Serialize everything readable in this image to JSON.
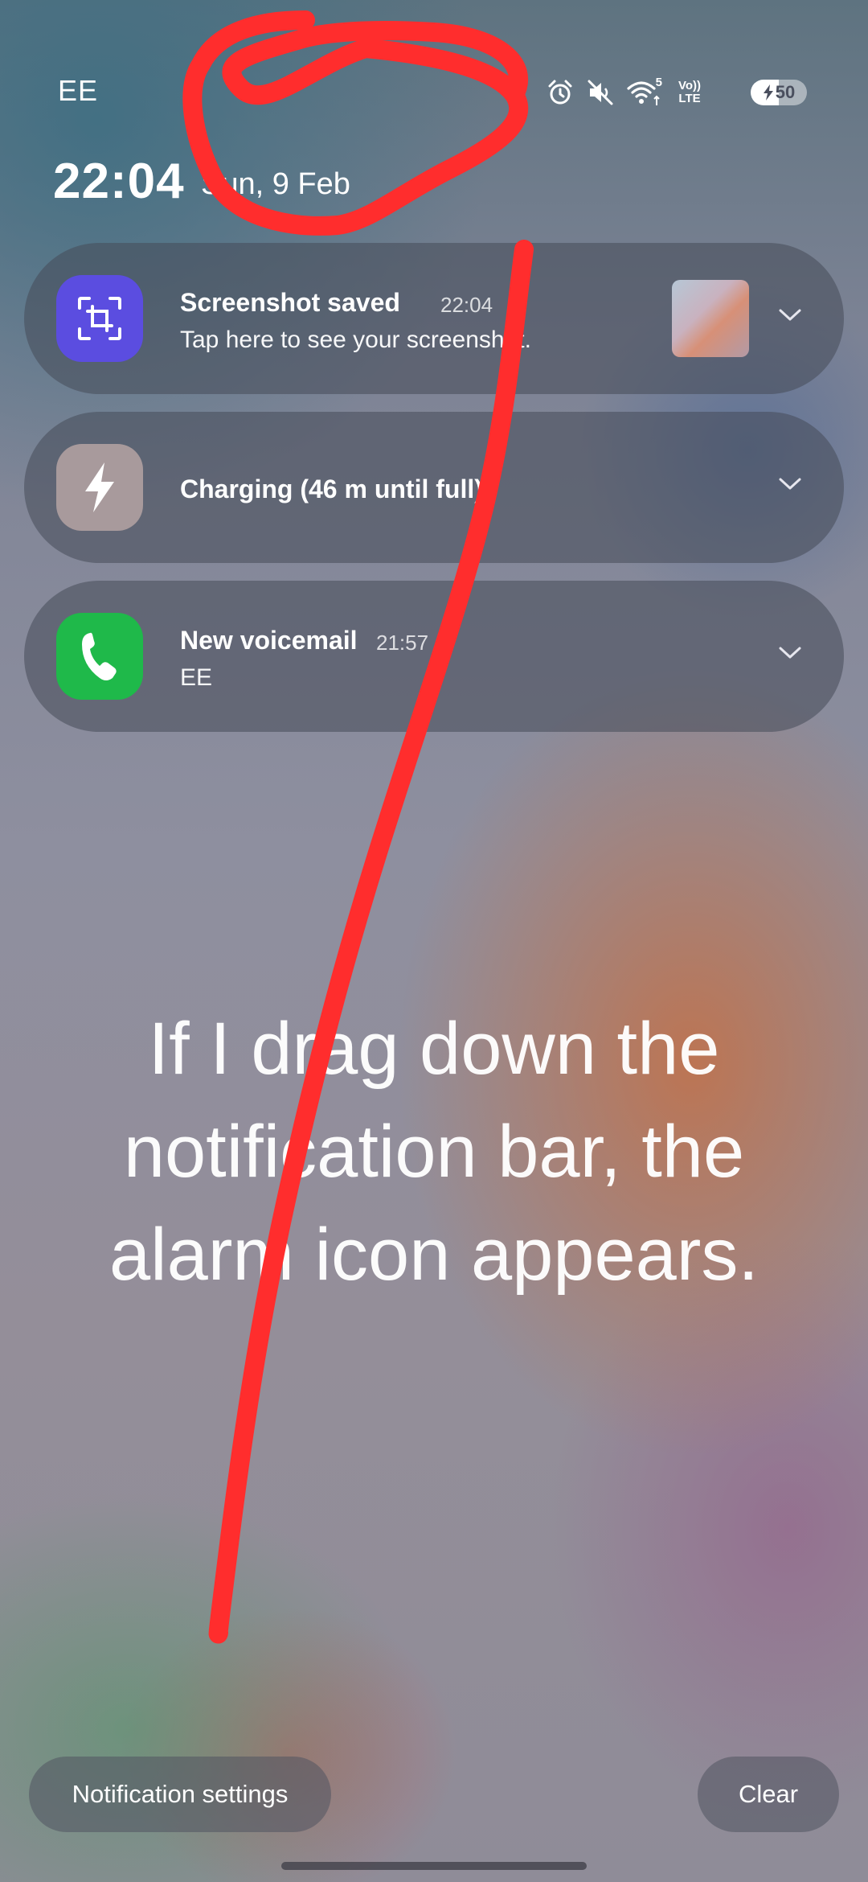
{
  "status_bar": {
    "carrier": "EE",
    "icons": [
      "alarm-icon",
      "mute-icon",
      "wifi-icon",
      "volte-icon"
    ],
    "wifi_label": "5",
    "volte_label_top": "Vo))",
    "volte_label_bottom": "LTE",
    "battery_level": "50",
    "battery_charging": true
  },
  "header": {
    "time": "22:04",
    "date": "Sun, 9 Feb"
  },
  "notifications": [
    {
      "app": "screenshot",
      "icon": "screenshot-icon",
      "title": "Screenshot saved",
      "time": "22:04",
      "body": "Tap here to see your screenshot."
    },
    {
      "app": "charging",
      "icon": "lightning-icon",
      "title": "Charging (46 m until full)"
    },
    {
      "app": "phone",
      "icon": "phone-icon",
      "title": "New voicemail",
      "time": "21:57",
      "body": "EE"
    }
  ],
  "overlay_message": "If I drag down the notification bar, the alarm icon appears.",
  "buttons": {
    "notification_settings": "Notification settings",
    "clear": "Clear"
  },
  "colors": {
    "annotation": "#ff2d2d",
    "screenshot_icon_bg": "#5b4de0",
    "charging_icon_bg": "#a89a9c",
    "phone_icon_bg": "#1fb94a"
  }
}
